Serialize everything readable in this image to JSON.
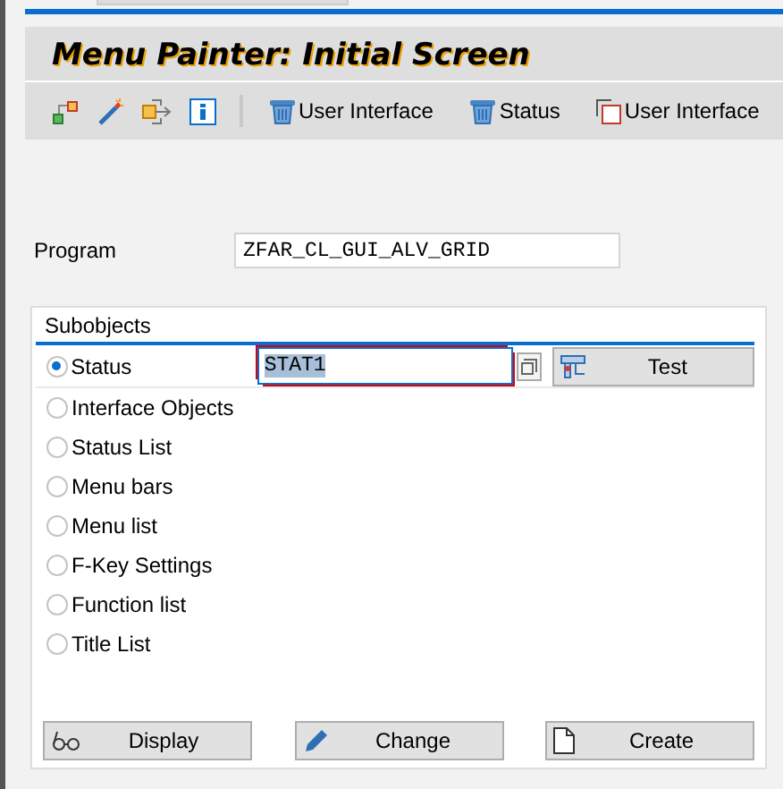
{
  "title": "Menu Painter: Initial Screen",
  "toolbar": {
    "icons": [
      {
        "kind": "hierarchy"
      },
      {
        "kind": "wand"
      },
      {
        "kind": "export"
      },
      {
        "kind": "info"
      }
    ],
    "buttons": [
      {
        "kind": "trash",
        "label": "User Interface"
      },
      {
        "kind": "trash",
        "label": "Status"
      },
      {
        "kind": "copy",
        "label": "User Interface"
      }
    ]
  },
  "program": {
    "label": "Program",
    "value": "ZFAR_CL_GUI_ALV_GRID"
  },
  "subobjects": {
    "title": "Subobjects",
    "options": [
      {
        "label": "Status",
        "selected": true
      },
      {
        "label": "Interface Objects",
        "selected": false
      },
      {
        "label": "Status List",
        "selected": false
      },
      {
        "label": "Menu bars",
        "selected": false
      },
      {
        "label": "Menu list",
        "selected": false
      },
      {
        "label": "F-Key Settings",
        "selected": false
      },
      {
        "label": "Function list",
        "selected": false
      },
      {
        "label": "Title List",
        "selected": false
      }
    ],
    "status_field": {
      "value": "STAT1",
      "value_selected": true
    },
    "test_button": {
      "label": "Test"
    },
    "actions": [
      {
        "kind": "display",
        "label": "Display"
      },
      {
        "kind": "change",
        "label": "Change"
      },
      {
        "kind": "create",
        "label": "Create"
      }
    ]
  }
}
